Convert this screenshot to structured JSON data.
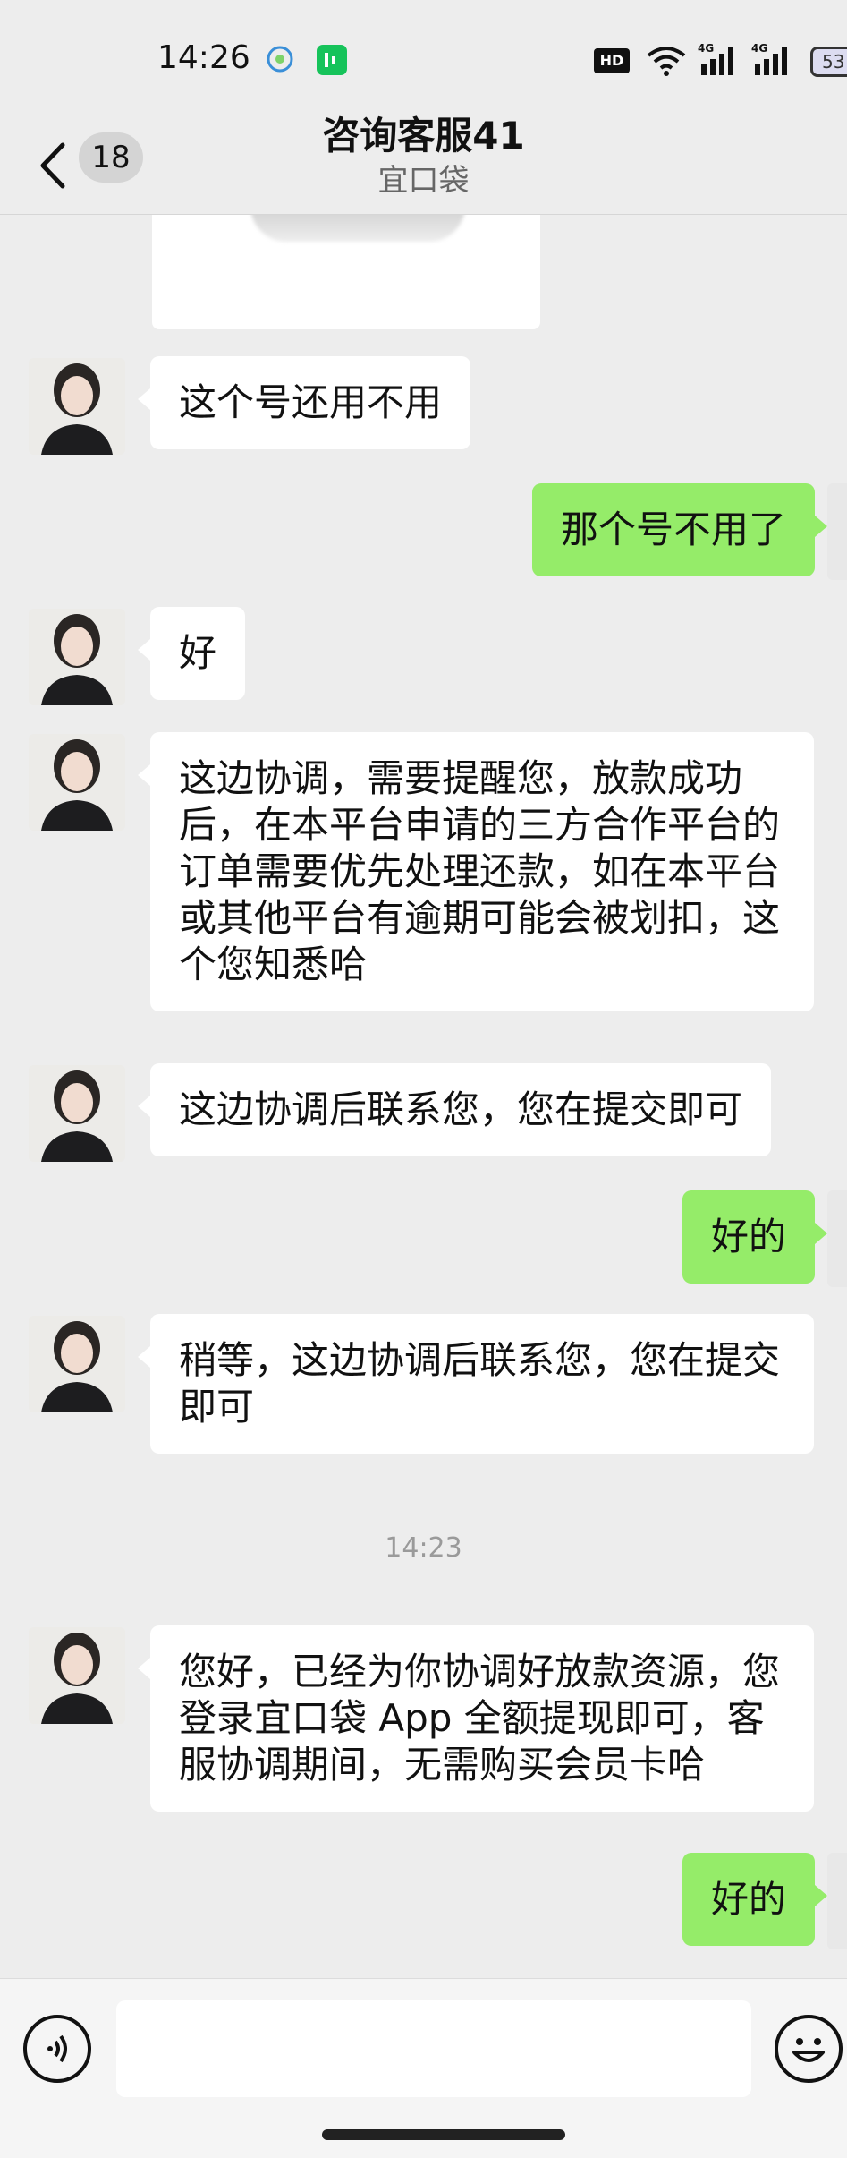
{
  "status_bar": {
    "time": "14:26",
    "hd_label": "HD",
    "network_1": "4G",
    "network_2": "4G",
    "battery": "53"
  },
  "nav": {
    "back_badge": "18",
    "title": "咨询客服41",
    "subtitle": "宜口袋"
  },
  "messages": [
    {
      "from": "agent",
      "text": "这个号还用不用"
    },
    {
      "from": "user",
      "text": "那个号不用了"
    },
    {
      "from": "agent",
      "text": "好"
    },
    {
      "from": "agent",
      "text": "这边协调，需要提醒您，放款成功后，在本平台申请的三方合作平台的订单需要优先处理还款，如在本平台或其他平台有逾期可能会被划扣，这个您知悉哈"
    },
    {
      "from": "agent",
      "text": "这边协调后联系您，您在提交即可"
    },
    {
      "from": "user",
      "text": "好的"
    },
    {
      "from": "agent",
      "text": "稍等，这边协调后联系您，您在提交即可"
    },
    {
      "from": "agent",
      "text": "您好，已经为你协调好放款资源，您登录宜口袋 App 全额提现即可，客服协调期间，无需购买会员卡哈"
    },
    {
      "from": "user",
      "text": "好的"
    }
  ],
  "timestamp": "14:23",
  "colors": {
    "background": "#ededed",
    "incoming_bubble": "#ffffff",
    "outgoing_bubble": "#95ec69"
  },
  "icons": [
    "back-chevron-icon",
    "voice-icon",
    "emoji-icon",
    "wifi-icon",
    "signal-icon",
    "battery-icon"
  ]
}
